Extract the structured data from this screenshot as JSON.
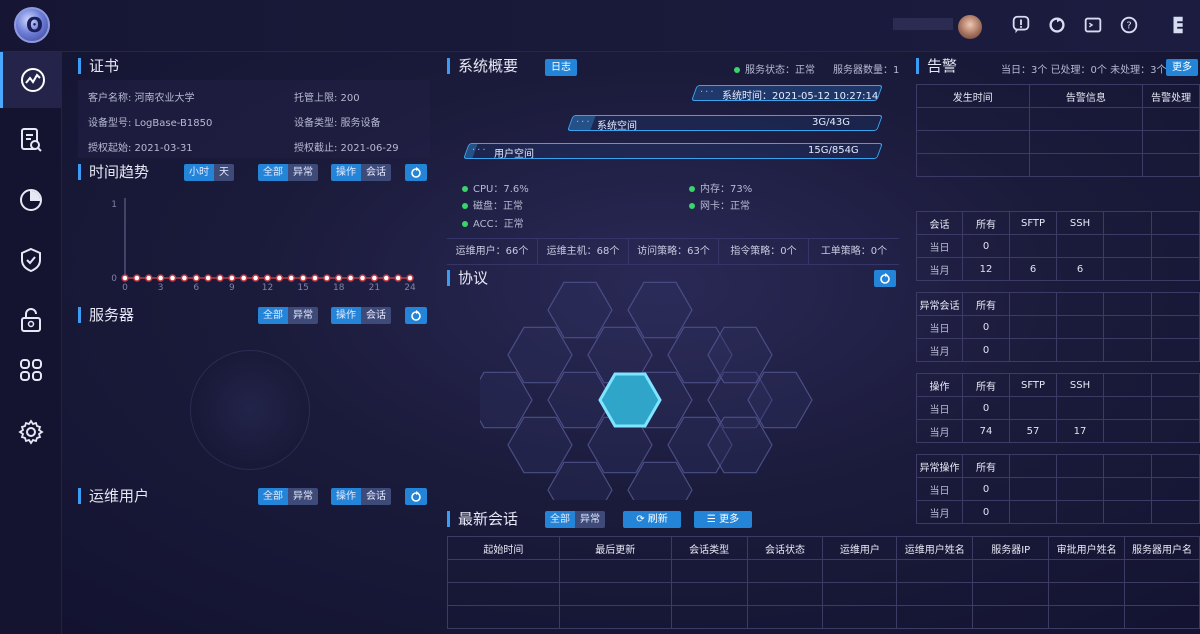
{
  "header": {
    "icons": [
      "user-avatar",
      "alert-icon",
      "refresh-icon",
      "terminal-icon",
      "help-icon",
      "logout-icon"
    ]
  },
  "sidebar": {
    "items": [
      "monitor-icon",
      "audit-search-icon",
      "report-pie-icon",
      "security-shield-icon",
      "unlock-icon",
      "apps-icon",
      "settings-gear-icon"
    ]
  },
  "certificate": {
    "title": "证书",
    "customer": "客户名称: 河南农业大学",
    "limit": "托管上限: 200",
    "device_model": "设备型号: LogBase-B1850",
    "device_type": "设备类型: 服务设备",
    "start": "授权起始: 2021-03-31",
    "end": "授权截止: 2021-06-29"
  },
  "trend": {
    "title": "时间趋势",
    "g1": [
      "小时",
      "天"
    ],
    "g2": [
      "全部",
      "异常"
    ],
    "g3": [
      "操作",
      "会话"
    ],
    "chart_data": {
      "type": "line",
      "x": [
        0,
        1,
        2,
        3,
        4,
        5,
        6,
        7,
        8,
        9,
        10,
        11,
        12,
        13,
        14,
        15,
        16,
        17,
        18,
        19,
        20,
        21,
        22,
        23,
        24
      ],
      "values": [
        0,
        0,
        0,
        0,
        0,
        0,
        0,
        0,
        0,
        0,
        0,
        0,
        0,
        0,
        0,
        0,
        0,
        0,
        0,
        0,
        0,
        0,
        0,
        0,
        0
      ],
      "xticks": [
        "0",
        "3",
        "6",
        "9",
        "12",
        "15",
        "18",
        "21",
        "24"
      ],
      "yticks": [
        "0",
        "1"
      ],
      "ylim": [
        0,
        1
      ],
      "xlim": [
        0,
        24
      ],
      "color": "#c23a44"
    }
  },
  "servers": {
    "title": "服务器",
    "g2": [
      "全部",
      "异常"
    ],
    "g3": [
      "操作",
      "会话"
    ]
  },
  "ops_users": {
    "title": "运维用户",
    "g2": [
      "全部",
      "异常"
    ],
    "g3": [
      "操作",
      "会话"
    ]
  },
  "overview": {
    "title": "系统概要",
    "log_btn": "日志",
    "service_status": "服务状态：正常",
    "server_count": "服务器数量：1",
    "system_time": "系统时间：2021-05-12 10:27:14",
    "system_space_label": "系统空间",
    "system_space": "3G/43G",
    "system_space_fill": 0.07,
    "user_space_label": "用户空间",
    "user_space": "15G/854G",
    "user_space_fill": 0.02,
    "cpu": "CPU：7.6%",
    "memory": "内存：73%",
    "disk": "磁盘：正常",
    "nic": "网卡：正常",
    "acc": "ACC：正常",
    "stats": [
      "运维用户：66个",
      "运维主机：68个",
      "访问策略：63个",
      "指令策略：0个",
      "工单策略：0个"
    ]
  },
  "protocol": {
    "title": "协议"
  },
  "sessions": {
    "title": "最新会话",
    "g2": [
      "全部",
      "异常"
    ],
    "refresh": "刷新",
    "more": "更多",
    "columns": [
      "起始时间",
      "最后更新",
      "会话类型",
      "会话状态",
      "运维用户",
      "运维用户姓名",
      "服务器IP",
      "审批用户姓名",
      "服务器用户名"
    ]
  },
  "alarm": {
    "title": "告警",
    "today": "当日：3个 已处理：0个 未处理：3个",
    "more": "更多",
    "columns": [
      "发生时间",
      "告警信息",
      "告警处理"
    ]
  },
  "session_stats": {
    "header": [
      "会话",
      "所有",
      "SFTP",
      "SSH"
    ],
    "rows": [
      [
        "当日",
        "0",
        "",
        ""
      ],
      [
        "当月",
        "12",
        "6",
        "6"
      ]
    ]
  },
  "abnormal_session": {
    "header": [
      "异常会话",
      "所有"
    ],
    "rows": [
      [
        "当日",
        "0"
      ],
      [
        "当月",
        "0"
      ]
    ]
  },
  "operation_stats": {
    "header": [
      "操作",
      "所有",
      "SFTP",
      "SSH"
    ],
    "rows": [
      [
        "当日",
        "0",
        "",
        ""
      ],
      [
        "当月",
        "74",
        "57",
        "17"
      ]
    ]
  },
  "abnormal_op": {
    "header": [
      "异常操作",
      "所有"
    ],
    "rows": [
      [
        "当日",
        "0"
      ],
      [
        "当月",
        "0"
      ]
    ]
  }
}
